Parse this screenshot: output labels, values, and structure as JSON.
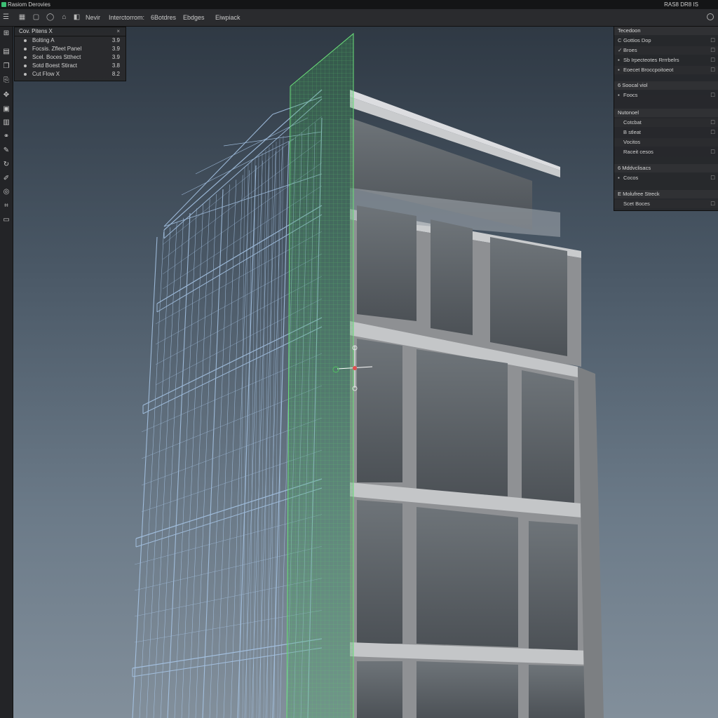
{
  "window": {
    "title": "Rasiom Derovies",
    "status": "RAS8 DR8 IS"
  },
  "toolbar": {
    "menus": [
      "Nevir",
      "Interctorrom:",
      "6Botdres",
      "Ebdges",
      "Eiwpiack"
    ],
    "icons": [
      "menu-icon",
      "grid-icon",
      "square-icon",
      "circle-icon",
      "lock-icon"
    ]
  },
  "left_tools": [
    "layers-icon",
    "list-icon",
    "duplicate-icon",
    "copy-icon",
    "move-icon",
    "frame-icon",
    "save-icon",
    "link-icon",
    "brush-icon",
    "rotate-icon",
    "pencil-icon",
    "sphere-icon",
    "section-icon",
    "clipboard-icon"
  ],
  "outliner": {
    "title": "Cov. Pitens X",
    "items": [
      {
        "label": "Bolting A",
        "value": "3.9"
      },
      {
        "label": "Focsis. Zfleet Panel",
        "value": "3.9"
      },
      {
        "label": "Scel. Boces Stthect",
        "value": "3.9"
      },
      {
        "label": "Sotd Boest Stiract",
        "value": "3.8"
      },
      {
        "label": "Cut Flow X",
        "value": "8.2"
      }
    ]
  },
  "properties": {
    "sections": [
      {
        "title": "Tecedoon",
        "items": [
          {
            "icon": "C",
            "label": "Gottios Dop"
          },
          {
            "icon": "✓",
            "label": "Broes"
          },
          {
            "icon": "▪",
            "label": "Sb Irpecteotes Rrrrbelrs"
          },
          {
            "icon": "▪",
            "label": "Eoecet Broccpoitoeot"
          }
        ]
      },
      {
        "title": "6 Soocal viol",
        "items": [
          {
            "icon": "▪",
            "label": "Foocs"
          }
        ]
      },
      {
        "title": "Nutonoel",
        "items": [
          {
            "icon": "",
            "label": "Cotcbat"
          },
          {
            "icon": "",
            "label": "B stleat"
          },
          {
            "icon": "",
            "label": "Vocitos"
          },
          {
            "icon": "",
            "label": "Raceit cesos"
          }
        ]
      },
      {
        "title": "6 Mddvclisacs",
        "items": [
          {
            "icon": "▪",
            "label": "Cocos"
          }
        ]
      },
      {
        "title": "E Molufree Streck",
        "items": [
          {
            "icon": "",
            "label": "Scet Boces"
          }
        ]
      }
    ]
  },
  "colors": {
    "wireframe": "#8fb8e0",
    "section_plane": "#45c05a",
    "gizmo_x": "#e05050",
    "gizmo_y": "#50c060",
    "facade": "#9a9a9a"
  }
}
